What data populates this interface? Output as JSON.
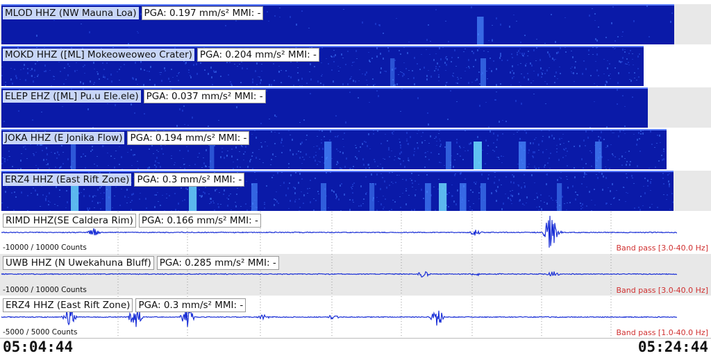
{
  "colors": {
    "spec_bg": "#0a1aa8",
    "trace": "#1a2fd6",
    "band_text": "#d03030",
    "gray_panel": "#e8e8e8"
  },
  "spectrograms": [
    {
      "station": "MLOD HHZ (NW Mauna Loa)",
      "pga": "PGA: 0.197 mm/s² MMI: -",
      "fill": 0.95
    },
    {
      "station": "MOKD HHZ ([ML] Mokeoweoweo Crater)",
      "pga": "PGA: 0.204 mm/s² MMI: -",
      "fill": 0.907
    },
    {
      "station": "ELEP EHZ ([ML] Pu.u Ele.ele)",
      "pga": "PGA: 0.037 mm/s² MMI: -",
      "fill": 0.913
    },
    {
      "station": "JOKA HHZ (E Jonika Flow)",
      "pga": "PGA: 0.194 mm/s² MMI: -",
      "fill": 0.939
    },
    {
      "station": "ERZ4 HHZ (East Rift Zone)",
      "pga": "PGA: 0.3 mm/s² MMI: -",
      "fill": 0.949
    }
  ],
  "waveforms": [
    {
      "station": "RIMD HHZ(SE Caldera Rim)",
      "pga": "PGA: 0.166 mm/s² MMI: -",
      "counts": "-10000 / 10000 Counts",
      "band": "Band pass [3.0-40.0 Hz]"
    },
    {
      "station": "UWB HHZ (N Uwekahuna Bluff)",
      "pga": "PGA: 0.285 mm/s² MMI: -",
      "counts": "-10000 / 10000 Counts",
      "band": "Band pass [3.0-40.0 Hz]"
    },
    {
      "station": "ERZ4 HHZ (East Rift Zone)",
      "pga": "PGA: 0.3 mm/s² MMI: -",
      "counts": "-5000 / 5000 Counts",
      "band": "Band pass [1.0-40.0 Hz]"
    }
  ],
  "time_start": "05:04:44",
  "time_end": "05:24:44"
}
